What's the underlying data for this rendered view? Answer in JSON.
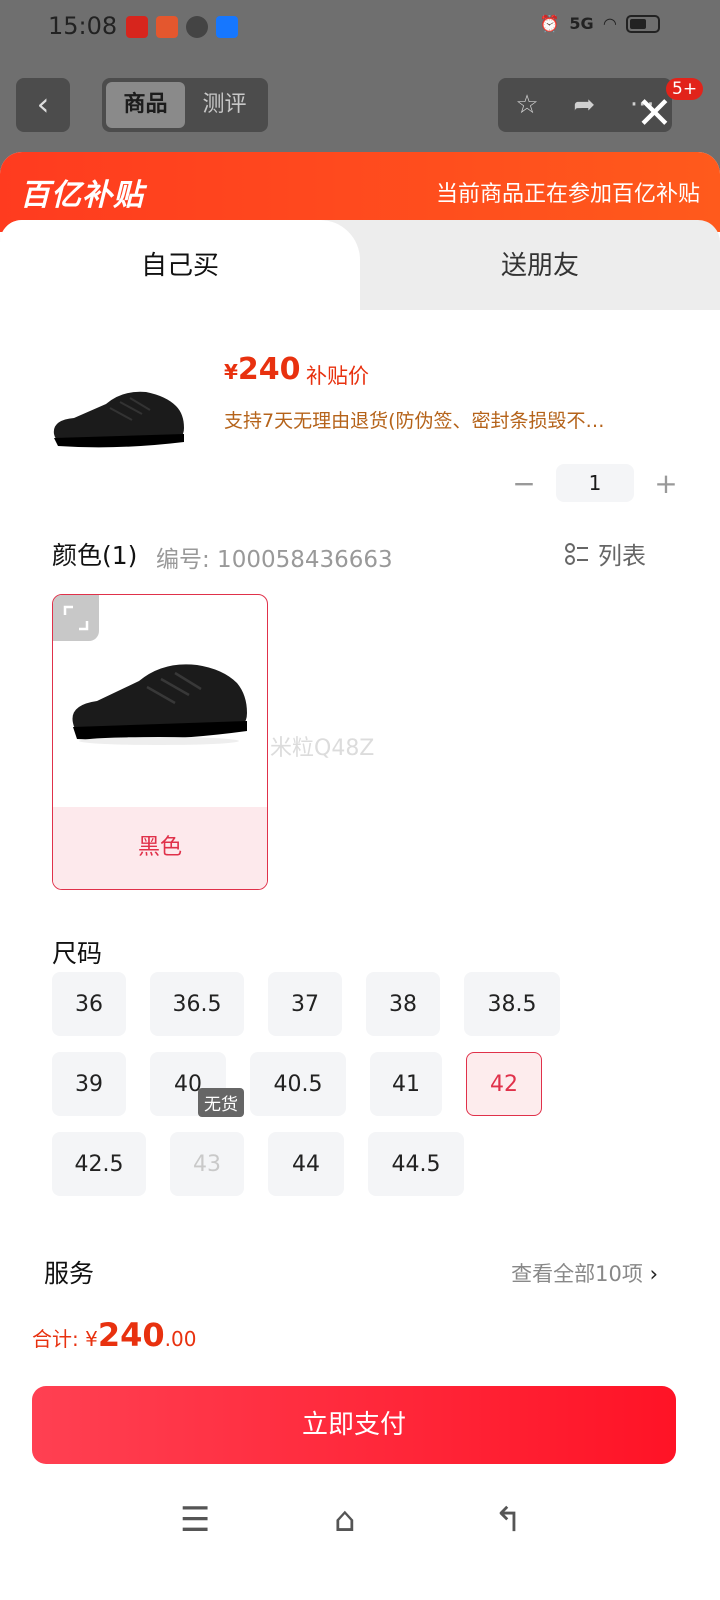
{
  "status": {
    "time": "15:08",
    "network": "5G"
  },
  "nav": {
    "back_icon": "chevron-left-icon",
    "tabs": [
      {
        "label": "商品"
      },
      {
        "label": "测评"
      }
    ],
    "badge": "5+",
    "close_icon": "close-icon"
  },
  "banner": {
    "logo": "百亿补贴",
    "message": "当前商品正在参加百亿补贴"
  },
  "tabs": {
    "self": "自己买",
    "friend": "送朋友"
  },
  "product": {
    "price_symbol": "¥",
    "price": "240",
    "price_label": "补贴价",
    "promo": "支持7天无理由退货(防伪签、密封条损毁不…",
    "quantity": "1",
    "minus": "−",
    "plus": "+"
  },
  "color": {
    "title": "颜色(1)",
    "code": "编号: 100058436663",
    "list_label": "列表",
    "option_label": "黑色",
    "watermark": "米粒Q48Z"
  },
  "size": {
    "title": "尺码",
    "options": [
      "36",
      "36.5",
      "37",
      "38",
      "38.5",
      "39",
      "40",
      "40.5",
      "41",
      "42",
      "42.5",
      "43",
      "44",
      "44.5"
    ],
    "selected": "42",
    "sold_out_tag": "无货"
  },
  "service": {
    "title": "服务",
    "more": "查看全部10项",
    "more_icon": "chevron-right-icon"
  },
  "footer": {
    "total_label": "合计: ",
    "total_symbol": "¥",
    "total_int": "240",
    "total_dec": ".00",
    "pay_label": "立即支付"
  },
  "colors": {
    "accent": "#e8310f",
    "select": "#e0314a",
    "banner": "#ff3b1f"
  }
}
